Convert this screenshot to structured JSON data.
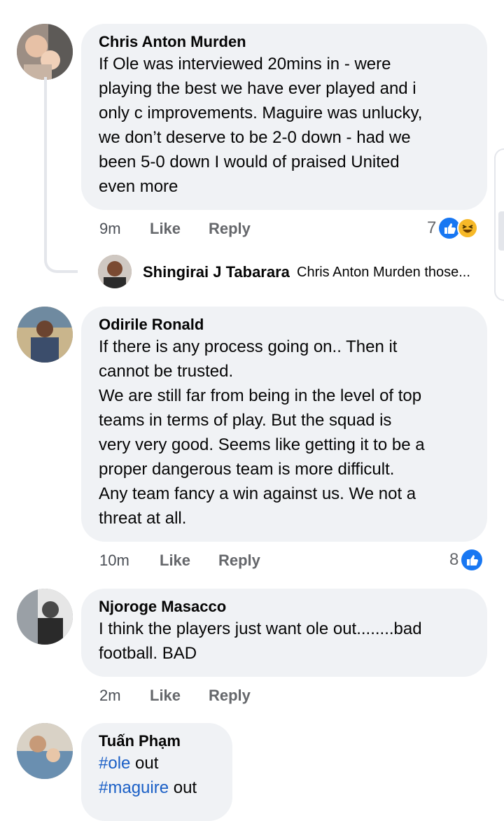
{
  "comments": [
    {
      "author": "Chris Anton Murden",
      "text": "If Ole was interviewed 20mins in - were\nplaying the best we have ever played and i\nonly c improvements.  Maguire was unlucky,\nwe don’t deserve to be 2-0 down - had we\nbeen 5-0 down I would of praised United\neven more",
      "time": "9m",
      "like_label": "Like",
      "reply_label": "Reply",
      "reaction_count": "7",
      "reactions": [
        "like-icon",
        "haha-icon"
      ]
    },
    {
      "author": "Odirile Ronald",
      "text": "If there is any process going on.. Then it\ncannot be trusted.\nWe are still far from being in the level of top\nteams in terms of play. But the squad is\nvery very good. Seems like getting it to be a\nproper dangerous team is more difficult.\nAny team fancy a win against us. We not a\nthreat at all.",
      "time": "10m",
      "like_label": "Like",
      "reply_label": "Reply",
      "reaction_count": "8",
      "reactions": [
        "like-icon"
      ]
    },
    {
      "author": "Njoroge Masacco",
      "text": "I think the players just want ole out........bad\nfootball. BAD",
      "time": "2m",
      "like_label": "Like",
      "reply_label": "Reply"
    },
    {
      "author": "Tuấn Phạm",
      "line1_tag": "#ole",
      "line1_rest": " out",
      "line2_tag": "#maguire",
      "line2_rest": " out"
    }
  ],
  "reply": {
    "author": "Shingirai J Tabarara",
    "snippet": "Chris Anton Murden those..."
  },
  "colors": {
    "bubble": "#f0f2f5",
    "like_blue": "#1877f2",
    "haha_yellow": "#f7b928",
    "hashtag": "#1a5fc6"
  }
}
